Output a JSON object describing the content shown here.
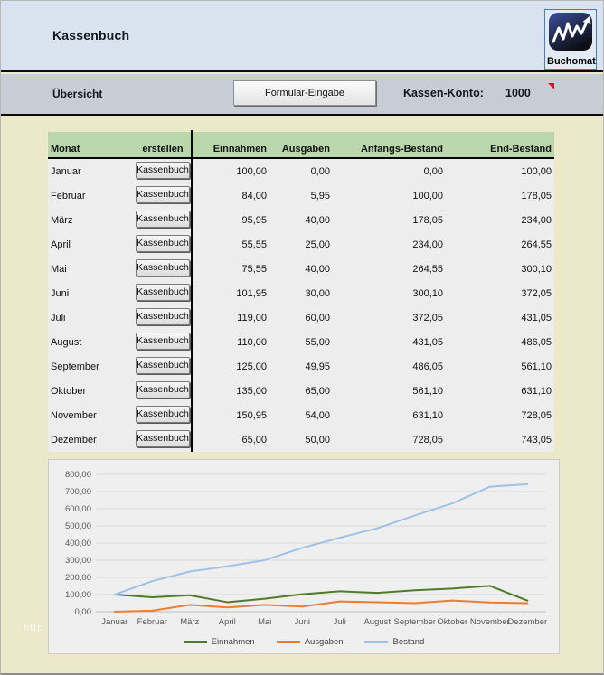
{
  "window": {
    "title": "Kassenbuch"
  },
  "logo": {
    "brand": "Buchomat"
  },
  "toolbar": {
    "section": "Übersicht",
    "form_button": "Formular-Eingabe",
    "account_label": "Kassen-Konto:",
    "account_value": "1000"
  },
  "colors": {
    "table_header_bg": "#b9d7ab",
    "comment_marker": "#e81123",
    "header_bg": "#d9e3f0",
    "page_bg": "#ece9ca"
  },
  "table": {
    "headers": {
      "monat": "Monat",
      "erstellen": "erstellen",
      "einnahmen": "Einnahmen",
      "ausgaben": "Ausgaben",
      "anfangs": "Anfangs-Bestand",
      "end": "End-Bestand"
    },
    "row_button": "Kassenbuch",
    "rows": [
      {
        "month": "Januar",
        "einnahmen": "100,00",
        "ausgaben": "0,00",
        "anfangs": "0,00",
        "end": "100,00"
      },
      {
        "month": "Februar",
        "einnahmen": "84,00",
        "ausgaben": "5,95",
        "anfangs": "100,00",
        "end": "178,05"
      },
      {
        "month": "März",
        "einnahmen": "95,95",
        "ausgaben": "40,00",
        "anfangs": "178,05",
        "end": "234,00"
      },
      {
        "month": "April",
        "einnahmen": "55,55",
        "ausgaben": "25,00",
        "anfangs": "234,00",
        "end": "264,55"
      },
      {
        "month": "Mai",
        "einnahmen": "75,55",
        "ausgaben": "40,00",
        "anfangs": "264,55",
        "end": "300,10"
      },
      {
        "month": "Juni",
        "einnahmen": "101,95",
        "ausgaben": "30,00",
        "anfangs": "300,10",
        "end": "372,05"
      },
      {
        "month": "Juli",
        "einnahmen": "119,00",
        "ausgaben": "60,00",
        "anfangs": "372,05",
        "end": "431,05"
      },
      {
        "month": "August",
        "einnahmen": "110,00",
        "ausgaben": "55,00",
        "anfangs": "431,05",
        "end": "486,05"
      },
      {
        "month": "September",
        "einnahmen": "125,00",
        "ausgaben": "49,95",
        "anfangs": "486,05",
        "end": "561,10"
      },
      {
        "month": "Oktober",
        "einnahmen": "135,00",
        "ausgaben": "65,00",
        "anfangs": "561,10",
        "end": "631,10"
      },
      {
        "month": "November",
        "einnahmen": "150,95",
        "ausgaben": "54,00",
        "anfangs": "631,10",
        "end": "728,05"
      },
      {
        "month": "Dezember",
        "einnahmen": "65,00",
        "ausgaben": "50,00",
        "anfangs": "728,05",
        "end": "743,05"
      }
    ]
  },
  "watermark": "http",
  "chart_data": {
    "type": "line",
    "categories": [
      "Januar",
      "Februar",
      "März",
      "April",
      "Mai",
      "Juni",
      "Juli",
      "August",
      "September",
      "Oktober",
      "November",
      "Dezember"
    ],
    "series": [
      {
        "name": "Einnahmen",
        "color": "#4f7b2a",
        "values": [
          100,
          84,
          95.95,
          55.55,
          75.55,
          101.95,
          119,
          110,
          125,
          135,
          150.95,
          65
        ]
      },
      {
        "name": "Ausgaben",
        "color": "#ed7d31",
        "values": [
          0,
          5.95,
          40,
          25,
          40,
          30,
          60,
          55,
          49.95,
          65,
          54,
          50
        ]
      },
      {
        "name": "Bestand",
        "color": "#9dc3e6",
        "values": [
          100,
          178.05,
          234,
          264.55,
          300.1,
          372.05,
          431.05,
          486.05,
          561.1,
          631.1,
          728.05,
          743.05
        ]
      }
    ],
    "title": "",
    "xlabel": "",
    "ylabel": "",
    "ylim": [
      0,
      800
    ],
    "ytick_step": 100,
    "ytick_labels": [
      "0,00",
      "100,00",
      "200,00",
      "300,00",
      "400,00",
      "500,00",
      "600,00",
      "700,00",
      "800,00"
    ],
    "grid": true,
    "legend_position": "bottom"
  }
}
